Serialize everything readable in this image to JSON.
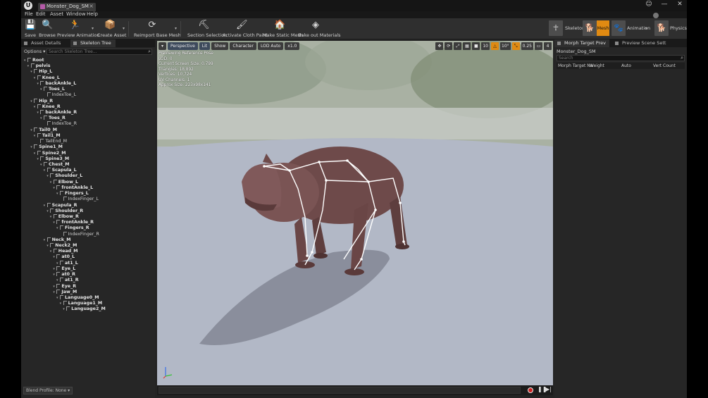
{
  "app": {
    "logo": "U",
    "tab_title": "Monster_Dog_SM",
    "tab_close": "×",
    "window_buttons": [
      "☺",
      "—",
      "✕"
    ]
  },
  "menu": [
    "File",
    "Edit",
    "Asset",
    "Window",
    "Help"
  ],
  "toolbar": {
    "save": "Save",
    "browse": "Browse",
    "preview_animation": "Preview Animation",
    "create_asset": "Create Asset",
    "reimport": "Reimport Base Mesh",
    "section_selection": "Section Selection",
    "cloth_paint": "Activate Cloth Paint",
    "make_static": "Make Static Mesh",
    "bake_materials": "Bake out Materials"
  },
  "modes": {
    "skeleton": "Skeleton",
    "mesh": "Mesh",
    "animation": "Animation",
    "physics": "Physics",
    "active_color": "#e08a12"
  },
  "left_panel": {
    "tab_asset_details": "Asset Details",
    "tab_skeleton_tree": "Skeleton Tree",
    "options": "Options ▾",
    "search_placeholder": "Search Skeleton Tree...",
    "blend_profile": "Blend Profile: None ▾",
    "bones": [
      {
        "name": "Root",
        "depth": 0,
        "bold": true
      },
      {
        "name": "pelvis",
        "depth": 1,
        "bold": true
      },
      {
        "name": "Hip_L",
        "depth": 2,
        "bold": true
      },
      {
        "name": "Knee_L",
        "depth": 3,
        "bold": true
      },
      {
        "name": "backAnkle_L",
        "depth": 4,
        "bold": true
      },
      {
        "name": "Toes_L",
        "depth": 5,
        "bold": true
      },
      {
        "name": "IndexToe_L",
        "depth": 6,
        "bold": false
      },
      {
        "name": "Hip_R",
        "depth": 2,
        "bold": true
      },
      {
        "name": "Knee_R",
        "depth": 3,
        "bold": true
      },
      {
        "name": "backAnkle_R",
        "depth": 4,
        "bold": true
      },
      {
        "name": "Toes_R",
        "depth": 5,
        "bold": true
      },
      {
        "name": "IndexToe_R",
        "depth": 6,
        "bold": false
      },
      {
        "name": "Tail0_M",
        "depth": 2,
        "bold": true
      },
      {
        "name": "Tail1_M",
        "depth": 3,
        "bold": true
      },
      {
        "name": "TailEnd_M",
        "depth": 4,
        "bold": false
      },
      {
        "name": "Spine1_M",
        "depth": 2,
        "bold": true
      },
      {
        "name": "Spine2_M",
        "depth": 3,
        "bold": true
      },
      {
        "name": "Spine3_M",
        "depth": 4,
        "bold": true
      },
      {
        "name": "Chest_M",
        "depth": 5,
        "bold": true
      },
      {
        "name": "Scapula_L",
        "depth": 6,
        "bold": true
      },
      {
        "name": "Shoulder_L",
        "depth": 7,
        "bold": true
      },
      {
        "name": "Elbow_L",
        "depth": 8,
        "bold": true
      },
      {
        "name": "frontAnkle_L",
        "depth": 9,
        "bold": true
      },
      {
        "name": "Fingers_L",
        "depth": 10,
        "bold": true
      },
      {
        "name": "IndexFinger_L",
        "depth": 11,
        "bold": false
      },
      {
        "name": "Scapula_R",
        "depth": 6,
        "bold": true
      },
      {
        "name": "Shoulder_R",
        "depth": 7,
        "bold": true
      },
      {
        "name": "Elbow_R",
        "depth": 8,
        "bold": true
      },
      {
        "name": "frontAnkle_R",
        "depth": 9,
        "bold": true
      },
      {
        "name": "Fingers_R",
        "depth": 10,
        "bold": true
      },
      {
        "name": "IndexFinger_R",
        "depth": 11,
        "bold": false
      },
      {
        "name": "Neck_M",
        "depth": 6,
        "bold": true
      },
      {
        "name": "Neck2_M",
        "depth": 7,
        "bold": true
      },
      {
        "name": "Head_M",
        "depth": 8,
        "bold": true
      },
      {
        "name": "at0_L",
        "depth": 9,
        "bold": true
      },
      {
        "name": "at1_L",
        "depth": 10,
        "bold": true
      },
      {
        "name": "Eye_L",
        "depth": 9,
        "bold": true
      },
      {
        "name": "at0_R",
        "depth": 9,
        "bold": true
      },
      {
        "name": "at1_R",
        "depth": 10,
        "bold": true
      },
      {
        "name": "Eye_R",
        "depth": 9,
        "bold": true
      },
      {
        "name": "Jaw_M",
        "depth": 9,
        "bold": true
      },
      {
        "name": "Language0_M",
        "depth": 10,
        "bold": true
      },
      {
        "name": "Language1_M",
        "depth": 11,
        "bold": true
      },
      {
        "name": "Language2_M",
        "depth": 12,
        "bold": true
      }
    ]
  },
  "viewport": {
    "menu_arrow": "▾",
    "perspective": "Perspective",
    "lit": "Lit",
    "show": "Show",
    "character": "Character",
    "lod": "LOD Auto",
    "speed": "x1.0",
    "right_tools": [
      "✥",
      "⟳",
      "⤢",
      "▦",
      "■",
      "10",
      "△",
      "10°",
      "⤡",
      "0.25",
      "▭",
      "4"
    ],
    "info": [
      "Previewing Reference Pose",
      "LOD: 0",
      "Current Screen Size: 0.799",
      "Triangles: 18,892",
      "Vertices: 10,724",
      "UV Channels: 1",
      "Approx Size: 223x98x141"
    ]
  },
  "timeline": {
    "pause": "❚❚",
    "next": "▶|"
  },
  "right_panel": {
    "tab_morph": "Morph Target Prev",
    "tab_preview_scene": "Preview Scene Sett",
    "asset_name": "Monster_Dog_SM",
    "search_placeholder": "Search",
    "columns": [
      "Morph Target Na",
      "Weight",
      "Auto",
      "Vert Count"
    ]
  }
}
